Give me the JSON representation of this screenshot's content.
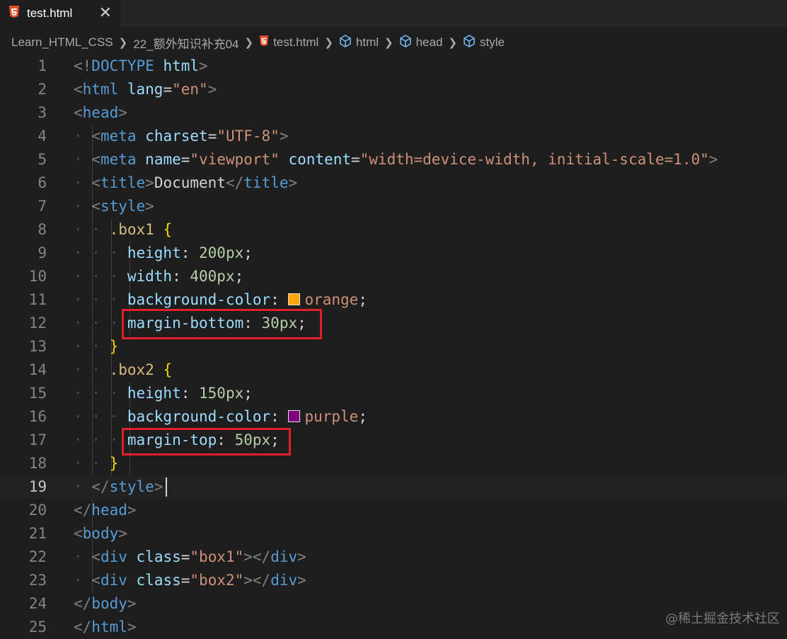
{
  "tab": {
    "title": "test.html",
    "icon": "html5-icon",
    "close": "✕"
  },
  "breadcrumb": {
    "items": [
      {
        "label": "Learn_HTML_CSS"
      },
      {
        "label": "22_额外知识补充04"
      },
      {
        "label": "test.html",
        "icon": "html5-icon"
      },
      {
        "label": "html",
        "icon": "cube-icon"
      },
      {
        "label": "head",
        "icon": "cube-icon"
      },
      {
        "label": "style",
        "icon": "cube-icon"
      }
    ]
  },
  "editor": {
    "current_line": 19,
    "line_numbers": [
      "1",
      "2",
      "3",
      "4",
      "5",
      "6",
      "7",
      "8",
      "9",
      "10",
      "11",
      "12",
      "13",
      "14",
      "15",
      "16",
      "17",
      "18",
      "19",
      "20",
      "21",
      "22",
      "23",
      "24",
      "25"
    ],
    "tokens": {
      "l1": [
        "<!",
        "DOCTYPE",
        " html",
        ">"
      ],
      "l2": [
        "<",
        "html",
        " lang",
        "=",
        "\"en\"",
        ">"
      ],
      "l3": [
        "<",
        "head",
        ">"
      ],
      "l4": [
        "<",
        "meta",
        " charset",
        "=",
        "\"UTF-8\"",
        ">"
      ],
      "l5": [
        "<",
        "meta",
        " name",
        "=",
        "\"viewport\"",
        " content",
        "=",
        "\"width=device-width, initial-scale=1.0\"",
        ">"
      ],
      "l6": [
        "<",
        "title",
        ">",
        "Document",
        "</",
        "title",
        ">"
      ],
      "l7": [
        "<",
        "style",
        ">"
      ],
      "l8": [
        ".box1",
        " {"
      ],
      "l9": [
        "height",
        ": ",
        "200px",
        ";"
      ],
      "l10": [
        "width",
        ": ",
        "400px",
        ";"
      ],
      "l11": [
        "background-color",
        ": ",
        "orange",
        ";"
      ],
      "l12": [
        "margin-bottom",
        ": ",
        "30px",
        ";"
      ],
      "l13": [
        "}"
      ],
      "l14": [
        ".box2",
        " {"
      ],
      "l15": [
        "height",
        ": ",
        "150px",
        ";"
      ],
      "l16": [
        "background-color",
        ": ",
        "purple",
        ";"
      ],
      "l17": [
        "margin-top",
        ": ",
        "50px",
        ";"
      ],
      "l18": [
        "}"
      ],
      "l19": [
        "</",
        "style",
        ">"
      ],
      "l20": [
        "</",
        "head",
        ">"
      ],
      "l21": [
        "<",
        "body",
        ">"
      ],
      "l22": [
        "<",
        "div",
        " class",
        "=",
        "\"box1\"",
        "></",
        "div",
        ">"
      ],
      "l23": [
        "<",
        "div",
        " class",
        "=",
        "\"box2\"",
        "></",
        "div",
        ">"
      ],
      "l24": [
        "</",
        "body",
        ">"
      ],
      "l25": [
        "</",
        "html",
        ">"
      ]
    },
    "swatches": {
      "orange": "#ffa500",
      "purple": "#800080"
    }
  },
  "watermark": "@稀土掘金技术社区"
}
